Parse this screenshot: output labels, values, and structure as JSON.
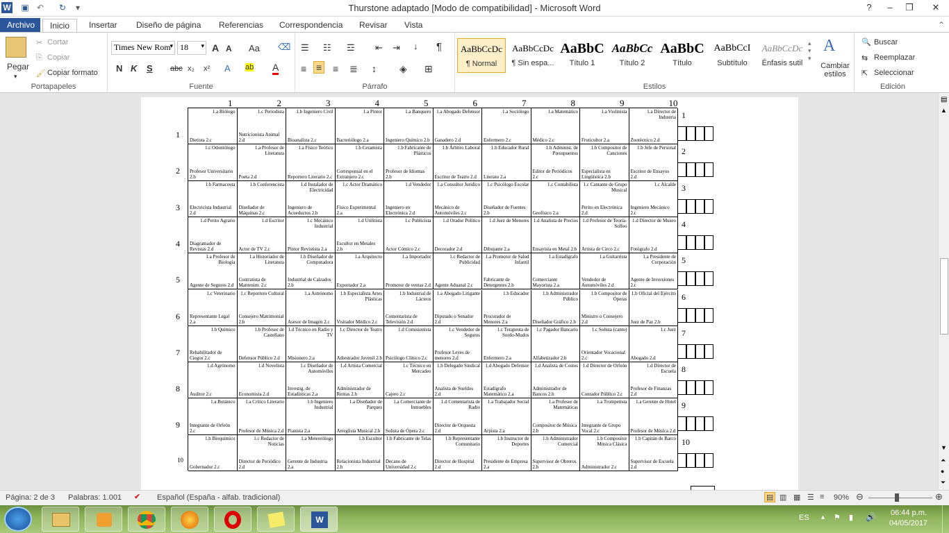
{
  "window": {
    "title": "Thurstone adaptado [Modo de compatibilidad]  -  Microsoft Word",
    "controls": [
      "?",
      "–",
      "❐",
      "✕"
    ]
  },
  "qat": {
    "app_letter": "W",
    "save_icon": "save-icon",
    "undo_icon": "undo-icon",
    "redo_icon": "redo-icon"
  },
  "tabs": [
    "Archivo",
    "Inicio",
    "Insertar",
    "Diseño de página",
    "Referencias",
    "Correspondencia",
    "Revisar",
    "Vista"
  ],
  "ribbon": {
    "clipboard": {
      "paste": "Pegar",
      "cut": "Cortar",
      "copy": "Copiar",
      "format_painter": "Copiar formato",
      "label": "Portapapeles"
    },
    "font": {
      "family": "Times New Rom",
      "size": "18",
      "label": "Fuente",
      "bold": "N",
      "italic": "K",
      "underline": "S",
      "strike": "abc",
      "sub": "x₂",
      "sup": "x²",
      "grow": "A",
      "shrink": "A",
      "case": "Aa",
      "highlight": "ab",
      "color": "A"
    },
    "paragraph": {
      "label": "Párrafo",
      "pilcrow": "¶"
    },
    "styles": {
      "label": "Estilos",
      "items": [
        {
          "preview": "AaBbCcDc",
          "name": "¶ Normal"
        },
        {
          "preview": "AaBbCcDc",
          "name": "¶ Sin espa..."
        },
        {
          "preview": "AaBbC",
          "name": "Título 1"
        },
        {
          "preview": "AaBbCc",
          "name": "Título 2"
        },
        {
          "preview": "AaBbC",
          "name": "Título"
        },
        {
          "preview": "AaBbCcI",
          "name": "Subtítulo"
        },
        {
          "preview": "AaBbCcDc",
          "name": "Énfasis sutil"
        }
      ],
      "change": "Cambiar estilos"
    },
    "editing": {
      "label": "Edición",
      "find": "Buscar",
      "replace": "Reemplazar",
      "select": "Seleccionar"
    }
  },
  "table": {
    "col_numbers": [
      "1",
      "2",
      "3",
      "4",
      "5",
      "6",
      "7",
      "8",
      "9",
      "10"
    ],
    "row_left_numbers": [
      "1",
      "2",
      "3",
      "4",
      "5",
      "6",
      "7",
      "8",
      "9",
      "10"
    ],
    "row_right_numbers": [
      "1",
      "2",
      "3",
      "4",
      "5",
      "6",
      "7",
      "8",
      "9",
      "10"
    ],
    "rows": [
      [
        [
          "1.a Biólogo",
          "Dietista 2.c"
        ],
        [
          "1.c Periodista",
          "Nutricionista Animal 2.d"
        ],
        [
          "1.b Ingeniero Civil",
          "Bioanalista 2.c"
        ],
        [
          "1.a Pintor",
          "Bacteriólogo 2.a"
        ],
        [
          "1.a Banquero",
          "Ingeniero Químico 2.b"
        ],
        [
          "1.a Abogado Defensor",
          "Ganadero 2.d"
        ],
        [
          "1.a Sociólogo",
          "Enfermero 2.c"
        ],
        [
          "1.a Matemático",
          "Médico 2.c"
        ],
        [
          "1.a Violinista",
          "Fruticultor 2.a"
        ],
        [
          "1.a Director de Industria",
          "Zootécnico 2.d"
        ]
      ],
      [
        [
          "1.c Odontólogo",
          "Profesor Universitario 2.b"
        ],
        [
          "1.a Profesor de Literatura",
          "Poeta 2.d"
        ],
        [
          "1.a Físico Teórico",
          "Reportero Literario 2.c"
        ],
        [
          "1.b Ceramista",
          "Corresponsal en el Extranjero 2.c"
        ],
        [
          "1.b Fabricante de Plásticos",
          "Profesor de Idiomas 2.b"
        ],
        [
          "1.b Árbitro Laboral",
          "Escritor de Teatro 2.d"
        ],
        [
          "1.b Educador Rural",
          "Literato 2.a"
        ],
        [
          "1.b Administ. de Presupuestos",
          "Editor de Periódicos 2.c"
        ],
        [
          "1.b Compositor de Canciones",
          "Especialista en Lingüística 2.b"
        ],
        [
          "1.b Jefe de Personal",
          "Escritor de Ensayos 2.d"
        ]
      ],
      [
        [
          "1.b Farmaceuta",
          "Electricista Industrial 2.d"
        ],
        [
          "1.b Conferencista",
          "Diseñador de Máquinas 2.c"
        ],
        [
          "1.d Instalador de Electricidad",
          "Ingeniero de Acueductos 2.b"
        ],
        [
          "1.c Actor Dramático",
          "Físico Experimental 2.a"
        ],
        [
          "1.d Vendedor",
          "Ingeniero en Electrónica 2.d"
        ],
        [
          "1.a Consultor Jurídico",
          "Mecánico de Automóviles 2.c"
        ],
        [
          "1.c Psicólogo Escolar",
          "Diseñador de Fuentes 2.b"
        ],
        [
          "1.c Contabilista",
          "Geofísico 2.a"
        ],
        [
          "1.c Cantante de Grupo Musical",
          "Perito en Electrónica 2.d"
        ],
        [
          "1.c Alcalde",
          "Ingeniero Mecánico 2.c"
        ]
      ],
      [
        [
          "1.d Perito Agrario",
          "Diagramador de Revistas 2.d"
        ],
        [
          "1.d Escritor",
          "Actor de TV 2.c"
        ],
        [
          "1.c Mecánico Industrial",
          "Pintor Revistista 2.a"
        ],
        [
          "1.d Utilitista",
          "Escultor en Metales 2.b"
        ],
        [
          "1.c Publicista",
          "Actor Cómico 2.c"
        ],
        [
          "1.d Orador Político",
          "Decorador 2.d"
        ],
        [
          "1.d Juez de Menores",
          "Dibujante 2.a"
        ],
        [
          "1.d Analista de Precios",
          "Ensayista en Metal 2.b"
        ],
        [
          "1.d Profesor de Teoría- Solfeo",
          "Artista de Circo 2.c"
        ],
        [
          "1.d Director de Museo",
          "Fotógrafo 2.d"
        ]
      ],
      [
        [
          "1.a Profesor de Biología",
          "Agente de Seguros 2.d"
        ],
        [
          "1.a Historiador de Literatura",
          "Contratista de Mantenim. 2.c"
        ],
        [
          "1.b Diseñador de Computadora",
          "Industrial de Calzados 2.b"
        ],
        [
          "1.a Arquitecto",
          "Exportador 2.a"
        ],
        [
          "1.a Importador",
          "Promotor de ventas 2.d"
        ],
        [
          "1.c Redactor de Publicidad",
          "Agente Aduanal 2.c"
        ],
        [
          "1.a Promotor de Salud Infantil",
          "Fabricante de Detergentes 2.b"
        ],
        [
          "1.a Estadígrafo",
          "Comerciante Mayorista 2.a"
        ],
        [
          "1.a Guitarrista",
          "Vendedor de Automóviles 2.d"
        ],
        [
          "1.a Presidente de Corporación",
          "Agente de Inversiones 2.c"
        ]
      ],
      [
        [
          "1.c Veterinario",
          "Representante Legal 2.a"
        ],
        [
          "1.c Reportero Cultural",
          "Consejero Matrimonial 2.b"
        ],
        [
          "1.a Astrónomo",
          "Asesor de Imagen 2.c"
        ],
        [
          "1.b Especialista Artes Plásticas",
          "Visitador Médico 2.c"
        ],
        [
          "1.b Industrial de Lácteos",
          "Comentarista de Televisión 2.d"
        ],
        [
          "1.a Abogado Litigante",
          "Diputado o Senador 2.d"
        ],
        [
          "1.b Educador",
          "Procurador de Menores 2.a"
        ],
        [
          "1.b Administrador Público",
          "Diseñador Gráfico 2.b"
        ],
        [
          "1.b Compositor de Óperas",
          "Ministro o Consejero 2.d"
        ],
        [
          "1.b Oficial del Ejército",
          "Juez de Paz 2.b"
        ]
      ],
      [
        [
          "1.b Químico",
          "Rehabilitador de Ciegos 2.c"
        ],
        [
          "1.b Profesor de Castellano",
          "Defensor Público 2.d"
        ],
        [
          "1.d Técnico en Radio y TV",
          "Misionero 2.a"
        ],
        [
          "1.c Director de Teatro",
          "Adiestrador Juvenil 2.b"
        ],
        [
          "1.d Comisionista",
          "Psicólogo Clínico 2.c"
        ],
        [
          "1.c Vendedor de Seguros",
          "Profesor Leyes de menores 2.d"
        ],
        [
          "1.c Terapeuta de Sordo-Mudos",
          "Enfermero 2.a"
        ],
        [
          "1.c Pagador Bancario",
          "Alfabetizador 2.b"
        ],
        [
          "1.c Solista (canto)",
          "Orientador Vocacional 2.c"
        ],
        [
          "1.c Juez",
          "Abogado 2.d"
        ]
      ],
      [
        [
          "1.d Agrónomo",
          "Auditor 2.c"
        ],
        [
          "1.d Novelista",
          "Economista 2.d"
        ],
        [
          "1.c Diseñador de Automóviles",
          "Investig. de Estadísticas 2.a"
        ],
        [
          "1.d Artista Comercial",
          "Administrador de Rentas 2.b"
        ],
        [
          "1.c Técnico en Mercadeo",
          "Cajero 2.c"
        ],
        [
          "1.b Delegado Sindical",
          "Analista de Sueldos 2.d"
        ],
        [
          "1.d Abogado Defensor",
          "Estadígrafo Matemático 2.a"
        ],
        [
          "1.d Analista de Costos",
          "Administrador de Bancos 2.b"
        ],
        [
          "1.d Director de Orfeón",
          "Contador Público 2.c"
        ],
        [
          "1.d Director de Escuela",
          "Profesor de Finanzas 2.d"
        ]
      ],
      [
        [
          "1.a Botánico",
          "Integrante de Orfeón 2.c"
        ],
        [
          "1.a Crítico Literario",
          "Profesor de Música 2.d"
        ],
        [
          "1.b Ingeniero Industrial",
          "Pianista 2.a"
        ],
        [
          "1.a Diseñador de Parques",
          "Arreglista Musical 2.b"
        ],
        [
          "1.a Comerciante de Inmuebles",
          "Solista de Ópera 2.c"
        ],
        [
          "1.d Comentarista de Radio",
          "Director de Orquesta 2.d"
        ],
        [
          "1.a Trabajador Social",
          "Arpista 2.a"
        ],
        [
          "1.a Profesor de Matemáticas",
          "Compositor de Música 2.b"
        ],
        [
          "1.a Trompetista",
          "Integrante de Grupo Vocal 2.c"
        ],
        [
          "1.a Gerente de Hotel",
          "Profesor de Música 2.d"
        ]
      ],
      [
        [
          "1.b Bioquímico",
          "Gobernador 2.c"
        ],
        [
          "1.c Redactor de Noticias",
          "Director de Periódico 2.d"
        ],
        [
          "1.a Meteorólogo",
          "Gerente de Industria 2.a"
        ],
        [
          "1.b Escultor",
          "Relacionista Industrial 2.b"
        ],
        [
          "1.b Fabricante de Telas",
          "Decano de Universidad 2.c"
        ],
        [
          "1.b Representante Comunitario",
          "Director de Hospital 2.d"
        ],
        [
          "1.b Instructor de Deportes",
          "Presidente de Empresa 2.a"
        ],
        [
          "1.b Administrador Comercial",
          "Supervisor de Obreros 2.b"
        ],
        [
          "1.b Compositor Música Clásica",
          "Administrador 2.c"
        ],
        [
          "1.b Capitán de Barco",
          "Supervisor de Escuela 2.d"
        ]
      ]
    ]
  },
  "status": {
    "page": "Página: 2 de 3",
    "words": "Palabras: 1.001",
    "language": "Español (España - alfab. tradicional)",
    "zoom": "90%"
  },
  "taskbar": {
    "lang": "ES",
    "time": "06:44 p.m.",
    "date": "04/05/2017"
  }
}
